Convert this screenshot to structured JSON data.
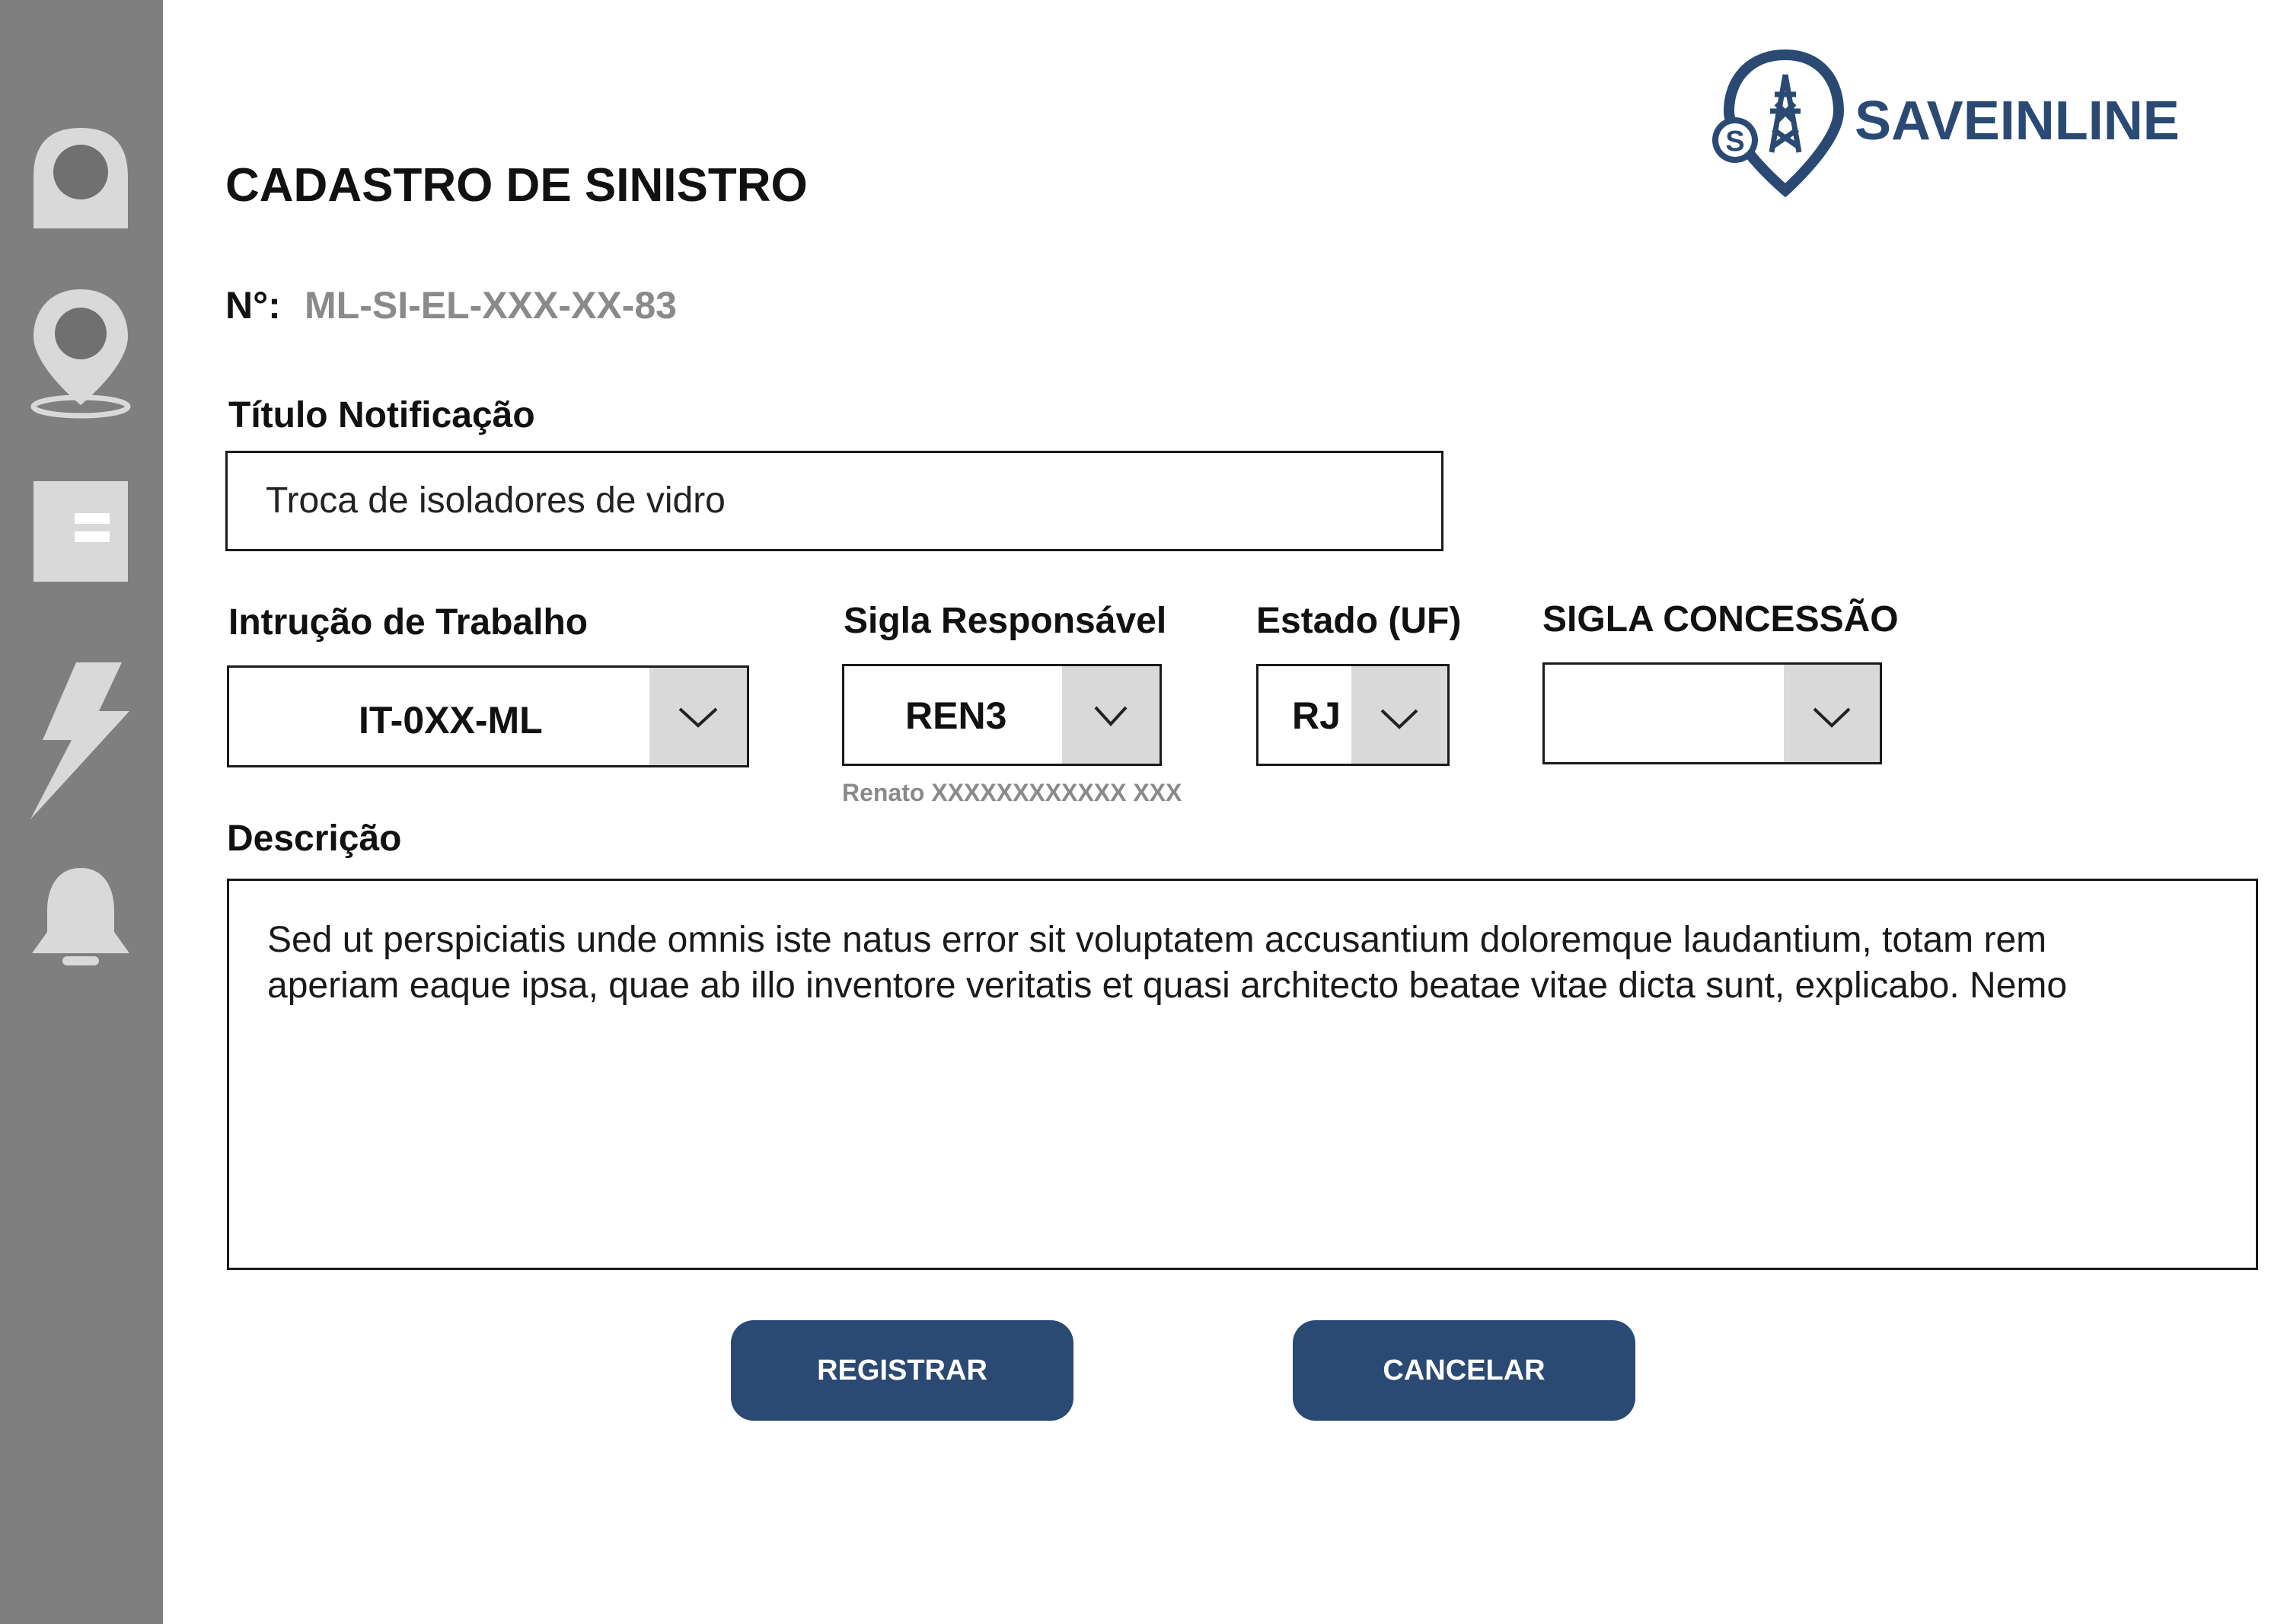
{
  "brand": {
    "name": "SAVEINLINE",
    "color": "#2a4a74"
  },
  "sidebar": {
    "items": [
      {
        "icon": "user-icon"
      },
      {
        "icon": "location-pin-icon"
      },
      {
        "icon": "document-icon"
      },
      {
        "icon": "lightning-icon"
      },
      {
        "icon": "bell-icon"
      }
    ]
  },
  "page": {
    "title": "CADASTRO DE SINISTRO",
    "number_label": "N°:",
    "number_value": "ML-SI-EL-XXX-XX-83"
  },
  "form": {
    "titulo": {
      "label": "Título Notificação",
      "value": "Troca de isoladores de vidro"
    },
    "instrucao": {
      "label": "Intrução de Trabalho",
      "value": "IT-0XX-ML"
    },
    "sigla_responsavel": {
      "label": "Sigla Responsável",
      "value": "REN3",
      "hint": "Renato XXXXXXXXXXXX XXX"
    },
    "estado": {
      "label": "Estado (UF)",
      "value": "RJ"
    },
    "sigla_concessao": {
      "label": "SIGLA CONCESSÃO",
      "value": ""
    },
    "descricao": {
      "label": "Descrição",
      "line1": "Sed ut perspiciatis unde omnis iste natus error sit voluptatem accusantium doloremque laudantium, totam rem",
      "line2": "aperiam eaque ipsa, quae ab illo inventore veritatis et quasi architecto beatae vitae dicta sunt, explicabo. Nemo"
    }
  },
  "actions": {
    "register_label": "REGISTRAR",
    "cancel_label": "CANCELAR"
  }
}
